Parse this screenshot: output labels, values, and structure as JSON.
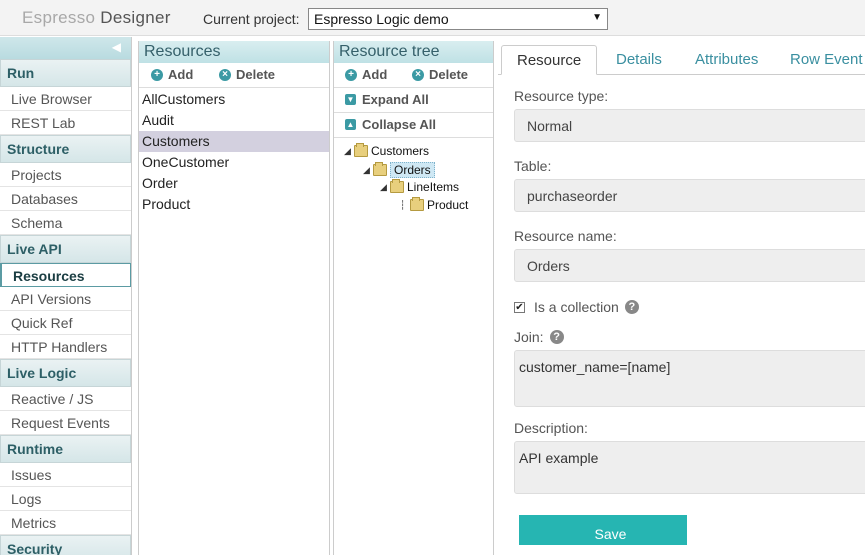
{
  "header": {
    "brand_part1": "Espresso",
    "brand_part2": "Designer",
    "project_label": "Current project:",
    "project_value": "Espresso Logic demo"
  },
  "sidebar": {
    "sections": [
      {
        "title": "Run",
        "items": [
          "Live Browser",
          "REST Lab"
        ]
      },
      {
        "title": "Structure",
        "items": [
          "Projects",
          "Databases",
          "Schema"
        ]
      },
      {
        "title": "Live API",
        "items": [
          "Resources",
          "API Versions",
          "Quick Ref",
          "HTTP Handlers"
        ]
      },
      {
        "title": "Live Logic",
        "items": [
          "Reactive / JS",
          "Request Events"
        ]
      },
      {
        "title": "Runtime",
        "items": [
          "Issues",
          "Logs",
          "Metrics"
        ]
      },
      {
        "title": "Security",
        "items": []
      }
    ],
    "active_item": "Resources"
  },
  "resources_panel": {
    "title": "Resources",
    "add_label": "Add",
    "delete_label": "Delete",
    "items": [
      "AllCustomers",
      "Audit",
      "Customers",
      "OneCustomer",
      "Order",
      "Product"
    ],
    "selected": "Customers"
  },
  "tree_panel": {
    "title": "Resource tree",
    "add_label": "Add",
    "delete_label": "Delete",
    "expand_label": "Expand All",
    "collapse_label": "Collapse All",
    "nodes": [
      {
        "label": "Customers",
        "depth": 0
      },
      {
        "label": "Orders",
        "depth": 1,
        "selected": true
      },
      {
        "label": "LineItems",
        "depth": 2
      },
      {
        "label": "Product",
        "depth": 3
      }
    ]
  },
  "detail": {
    "tabs": [
      "Resource",
      "Details",
      "Attributes",
      "Row Event"
    ],
    "active_tab": "Resource",
    "resource_type_label": "Resource type:",
    "resource_type_value": "Normal",
    "table_label": "Table:",
    "table_value": "purchaseorder",
    "resource_name_label": "Resource name:",
    "resource_name_value": "Orders",
    "collection_label": "Is a collection",
    "collection_checked": true,
    "join_label": "Join:",
    "join_value": "customer_name=[name]",
    "description_label": "Description:",
    "description_value": "API example",
    "save_label": "Save"
  },
  "colors": {
    "accent": "#3b9aa4",
    "save_button": "#26b5b2",
    "header_gradient": "#bfe1e5",
    "selection": "#d3d0df"
  }
}
